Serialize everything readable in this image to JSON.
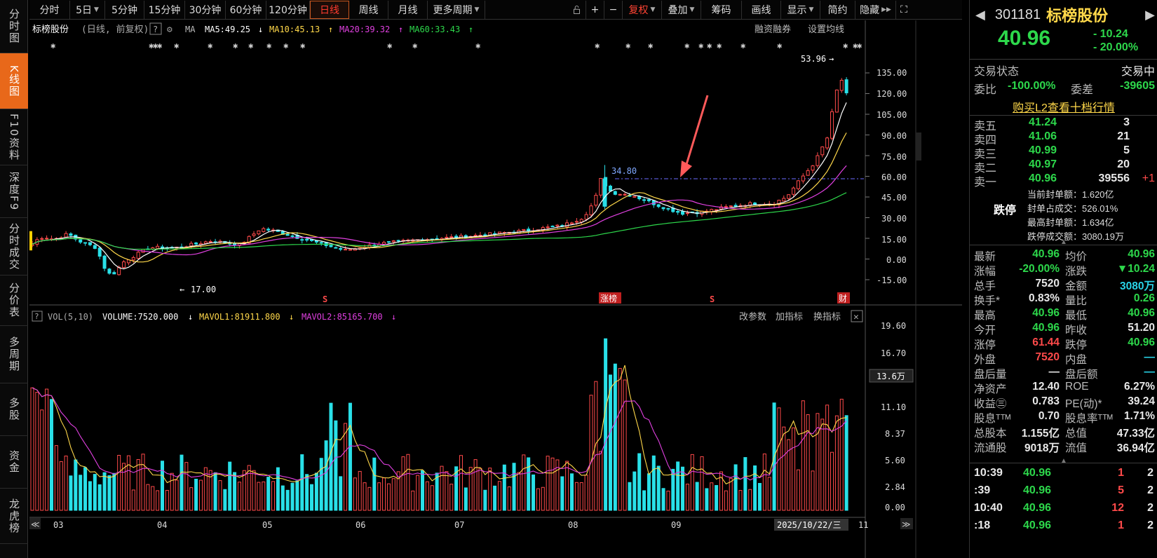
{
  "left_nav": [
    {
      "label": "分时图",
      "active": false
    },
    {
      "label": "K线图",
      "active": true
    },
    {
      "label": "F10资料",
      "active": false
    },
    {
      "label": "深度F9",
      "active": false
    },
    {
      "label": "分时成交",
      "active": false
    },
    {
      "label": "分价表",
      "active": false
    },
    {
      "label": "多周期",
      "active": false
    },
    {
      "label": "多股",
      "active": false
    },
    {
      "label": "资金",
      "active": false
    },
    {
      "label": "龙虎榜",
      "active": false
    }
  ],
  "toolbar": {
    "periods": [
      "分时",
      "5日",
      "5分钟",
      "15分钟",
      "30分钟",
      "60分钟",
      "120分钟",
      "日线",
      "周线",
      "月线",
      "更多周期"
    ],
    "active_period": "日线",
    "right_buttons": [
      "复权",
      "叠加",
      "筹码",
      "画线",
      "显示",
      "简约",
      "隐藏"
    ]
  },
  "chart_header": {
    "name": "标榜股份",
    "mode": "(日线, 前复权)",
    "ma_label": "MA",
    "ma5": "MA5:49.25",
    "ma10": "MA10:45.13",
    "ma20": "MA20:39.32",
    "ma60": "MA60:33.43",
    "right_links": [
      "融资融券",
      "设置均线"
    ]
  },
  "price_axis": [
    "135.00",
    "120.00",
    "105.00",
    "90.00",
    "75.00",
    "60.00",
    "45.00",
    "30.00",
    "15.00",
    "0.00",
    "-15.00"
  ],
  "annotations": {
    "high": "53.96",
    "low": "17.00",
    "level": "34.80",
    "tag_zhangbang": "涨榜",
    "tag_cai": "财",
    "tag_s": "S"
  },
  "vol_header": {
    "label": "VOL(5,10)",
    "volume": "VOLUME:7520.000",
    "mavol1": "MAVOL1:81911.800",
    "mavol2": "MAVOL2:85165.700",
    "links": [
      "改参数",
      "加指标",
      "换指标"
    ]
  },
  "vol_axis": [
    "19.60",
    "16.70",
    "13.6万",
    "11.10",
    "8.37",
    "5.60",
    "2.84",
    "0.00"
  ],
  "date_axis": {
    "months": [
      "03",
      "04",
      "05",
      "06",
      "07",
      "08",
      "09",
      "11"
    ],
    "current_date": "2025/10/22/三"
  },
  "quote": {
    "code": "301181",
    "name": "标榜股份",
    "price": "40.96",
    "change": "- 10.24",
    "pct": "- 20.00%",
    "trade_status_label": "交易状态",
    "trade_status": "交易中",
    "weibi_label": "委比",
    "weibi": "-100.00%",
    "weicha_label": "委差",
    "weicha": "-39605",
    "l2_link": "购买L2查看十档行情",
    "asks": [
      {
        "label": "卖五",
        "price": "41.24",
        "vol": "3",
        "chg": ""
      },
      {
        "label": "卖四",
        "price": "41.06",
        "vol": "21",
        "chg": ""
      },
      {
        "label": "卖三",
        "price": "40.99",
        "vol": "5",
        "chg": ""
      },
      {
        "label": "卖二",
        "price": "40.97",
        "vol": "20",
        "chg": ""
      },
      {
        "label": "卖一",
        "price": "40.96",
        "vol": "39556",
        "chg": "+1"
      }
    ],
    "limit_down_label": "跌停",
    "seal_info": [
      "当前封单额：1.620亿",
      "封单占成交：526.01%",
      "最高封单额：1.634亿",
      "跌停成交额：3080.19万"
    ],
    "stats": [
      {
        "l1": "最新",
        "v1": "40.96",
        "c1": "green",
        "l2": "均价",
        "v2": "40.96",
        "c2": "green"
      },
      {
        "l1": "涨幅",
        "v1": "-20.00%",
        "c1": "green",
        "l2": "涨跌",
        "v2": "▼10.24",
        "c2": "green"
      },
      {
        "l1": "总手",
        "v1": "7520",
        "c1": "white",
        "l2": "金额",
        "v2": "3080万",
        "c2": "cyan"
      },
      {
        "l1": "换手*",
        "v1": "0.83%",
        "c1": "white",
        "l2": "量比",
        "v2": "0.26",
        "c2": "green"
      },
      {
        "l1": "最高",
        "v1": "40.96",
        "c1": "green",
        "l2": "最低",
        "v2": "40.96",
        "c2": "green"
      },
      {
        "l1": "今开",
        "v1": "40.96",
        "c1": "green",
        "l2": "昨收",
        "v2": "51.20",
        "c2": "white"
      },
      {
        "l1": "涨停",
        "v1": "61.44",
        "c1": "red",
        "l2": "跌停",
        "v2": "40.96",
        "c2": "green"
      },
      {
        "l1": "外盘",
        "v1": "7520",
        "c1": "red",
        "l2": "内盘",
        "v2": "—",
        "c2": "cyan"
      },
      {
        "l1": "盘后量",
        "v1": "—",
        "c1": "white",
        "l2": "盘后额",
        "v2": "—",
        "c2": "cyan"
      },
      {
        "l1": "净资产",
        "v1": "12.40",
        "c1": "white",
        "l2": "ROE",
        "v2": "6.27%",
        "c2": "white"
      },
      {
        "l1": "收益㊂",
        "v1": "0.783",
        "c1": "white",
        "l2": "PE(动)*",
        "v2": "39.24",
        "c2": "white"
      },
      {
        "l1": "股息ᵀᵀᴹ",
        "v1": "0.70",
        "c1": "white",
        "l2": "股息率ᵀᵀᴹ",
        "v2": "1.71%",
        "c2": "white"
      },
      {
        "l1": "总股本",
        "v1": "1.155亿",
        "c1": "white",
        "l2": "总值",
        "v2": "47.33亿",
        "c2": "white"
      },
      {
        "l1": "流通股",
        "v1": "9018万",
        "c1": "white",
        "l2": "流值",
        "v2": "36.94亿",
        "c2": "white"
      }
    ],
    "ticks": [
      {
        "time": "10:39",
        "price": "40.96",
        "vol": "1",
        "n": "2"
      },
      {
        "time": ":39",
        "price": "40.96",
        "vol": "5",
        "n": "2"
      },
      {
        "time": "10:40",
        "price": "40.96",
        "vol": "12",
        "n": "2"
      },
      {
        "time": ":18",
        "price": "40.96",
        "vol": "1",
        "n": "2"
      }
    ]
  },
  "colors": {
    "up": "#ff4a4a",
    "down": "#29e0e8",
    "ma5": "#ffffff",
    "ma10": "#ffd84a",
    "ma20": "#e040e0",
    "ma60": "#2dd84b",
    "accent": "#e8681a"
  }
}
